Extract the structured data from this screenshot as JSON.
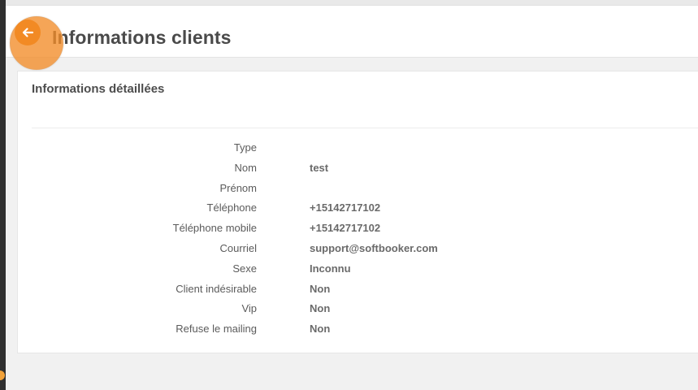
{
  "header": {
    "title": "Informations clients"
  },
  "card": {
    "title": "Informations détaillées",
    "rows": [
      {
        "label": "Type",
        "value": ""
      },
      {
        "label": "Nom",
        "value": "test"
      },
      {
        "label": "Prénom",
        "value": ""
      },
      {
        "label": "Téléphone",
        "value": "+15142717102"
      },
      {
        "label": "Téléphone mobile",
        "value": "+15142717102"
      },
      {
        "label": "Courriel",
        "value": "support@softbooker.com"
      },
      {
        "label": "Sexe",
        "value": "Inconnu"
      },
      {
        "label": "Client indésirable",
        "value": "Non"
      },
      {
        "label": "Vip",
        "value": "Non"
      },
      {
        "label": "Refuse le mailing",
        "value": "Non"
      }
    ]
  },
  "colors": {
    "accent": "#f28a24",
    "sidebar": "#2f2f2f",
    "background": "#f1f1f1"
  },
  "icons": {
    "back": "arrow-left-icon"
  }
}
